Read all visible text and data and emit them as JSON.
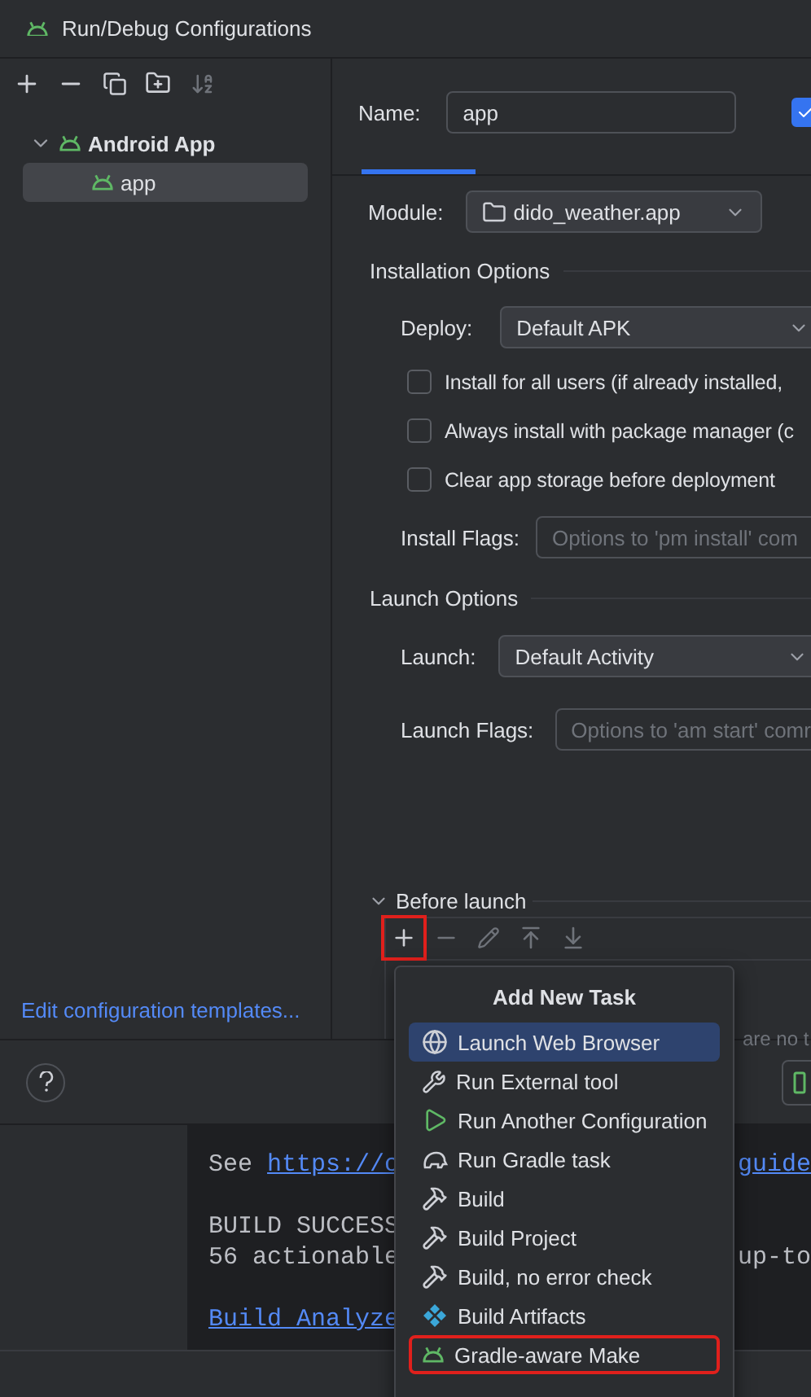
{
  "window": {
    "title": "Run/Debug Configurations"
  },
  "sidebar": {
    "tree": [
      {
        "label": "Android App",
        "expanded": true,
        "selected": false,
        "children": [
          {
            "label": "app",
            "selected": true
          }
        ]
      }
    ],
    "footer_link": "Edit configuration templates..."
  },
  "form": {
    "name_label": "Name:",
    "name_value": "app",
    "store_checkbox": {
      "checked": true
    },
    "tabs": [
      {
        "selected": true
      }
    ],
    "module_label": "Module:",
    "module_value": "dido_weather.app",
    "installation": {
      "title": "Installation Options",
      "deploy_label": "Deploy:",
      "deploy_value": "Default APK",
      "checkboxes": [
        {
          "label": "Install for all users (if already installed,",
          "checked": false
        },
        {
          "label": "Always install with package manager (c",
          "checked": false
        },
        {
          "label": "Clear app storage before deployment",
          "checked": false
        }
      ],
      "flags_label": "Install Flags:",
      "flags_placeholder": "Options to 'pm install' com"
    },
    "launch": {
      "title": "Launch Options",
      "launch_label": "Launch:",
      "launch_value": "Default Activity",
      "flags_label": "Launch Flags:",
      "flags_placeholder": "Options to 'am start' comr"
    },
    "before_launch": {
      "title": "Before launch",
      "expanded": true,
      "empty_text": "are no t",
      "tools": [
        {
          "kind": "add",
          "disabled": false,
          "highlighted": true
        },
        {
          "kind": "remove",
          "disabled": true,
          "highlighted": false
        },
        {
          "kind": "edit",
          "disabled": true,
          "highlighted": false
        },
        {
          "kind": "up",
          "disabled": true,
          "highlighted": false
        },
        {
          "kind": "down",
          "disabled": true,
          "highlighted": false
        }
      ]
    }
  },
  "popup": {
    "title": "Add New Task",
    "items": [
      {
        "kind": "browser",
        "label": "Launch Web Browser",
        "selected": true,
        "highlighted": false
      },
      {
        "kind": "tool",
        "label": "Run External tool",
        "selected": false,
        "highlighted": false
      },
      {
        "kind": "config",
        "label": "Run Another Configuration",
        "selected": false,
        "highlighted": false
      },
      {
        "kind": "gradle",
        "label": "Run Gradle task",
        "selected": false,
        "highlighted": false
      },
      {
        "kind": "build",
        "label": "Build",
        "selected": false,
        "highlighted": false
      },
      {
        "kind": "build",
        "label": "Build Project",
        "selected": false,
        "highlighted": false
      },
      {
        "kind": "build",
        "label": "Build, no error check",
        "selected": false,
        "highlighted": false
      },
      {
        "kind": "artifacts",
        "label": "Build Artifacts",
        "selected": false,
        "highlighted": false
      },
      {
        "kind": "android",
        "label": "Gradle-aware Make",
        "selected": false,
        "highlighted": true
      }
    ]
  },
  "console": {
    "lines": [
      {
        "parts": [
          {
            "text": "See ",
            "link": false
          },
          {
            "text": "https://c",
            "link": true
          }
        ],
        "tail": {
          "text": "guide",
          "link": true
        }
      },
      {
        "blank": true
      },
      {
        "parts": [
          {
            "text": "BUILD SUCCESS",
            "link": false
          }
        ]
      },
      {
        "parts": [
          {
            "text": "56 actionable",
            "link": false
          }
        ],
        "tail": {
          "text": "up-to",
          "link": false
        }
      },
      {
        "blank": true
      },
      {
        "parts": [
          {
            "text": "Build Analyze",
            "link": true
          }
        ]
      }
    ]
  }
}
